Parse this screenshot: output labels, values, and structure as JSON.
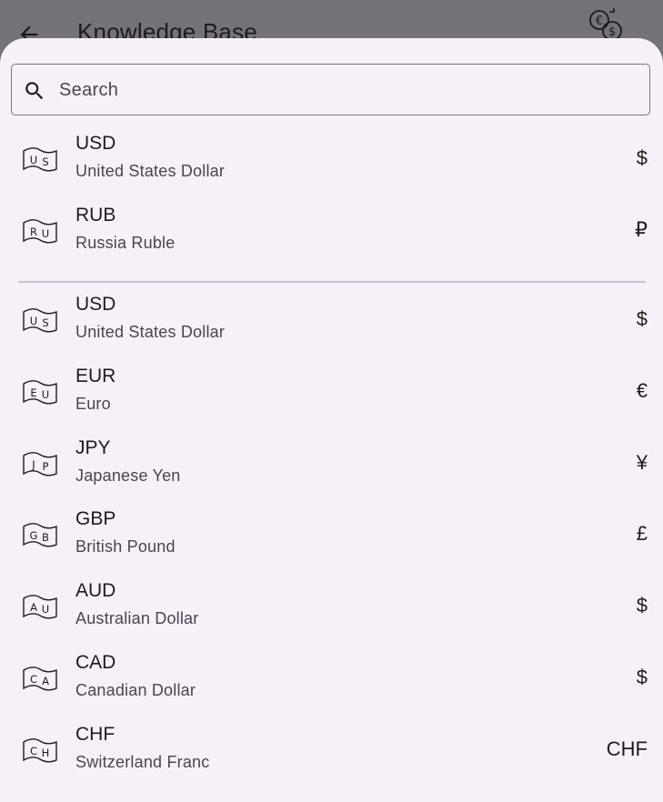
{
  "appbar": {
    "title": "Knowledge Base"
  },
  "search": {
    "placeholder": "Search",
    "value": ""
  },
  "pinned": [
    {
      "flag": "US",
      "code": "USD",
      "name": "United States Dollar",
      "symbol": "$"
    },
    {
      "flag": "RU",
      "code": "RUB",
      "name": "Russia Ruble",
      "symbol": "₽"
    }
  ],
  "all": [
    {
      "flag": "US",
      "code": "USD",
      "name": "United States Dollar",
      "symbol": "$"
    },
    {
      "flag": "EU",
      "code": "EUR",
      "name": "Euro",
      "symbol": "€"
    },
    {
      "flag": "JP",
      "code": "JPY",
      "name": "Japanese Yen",
      "symbol": "¥"
    },
    {
      "flag": "GB",
      "code": "GBP",
      "name": "British Pound",
      "symbol": "£"
    },
    {
      "flag": "AU",
      "code": "AUD",
      "name": "Australian Dollar",
      "symbol": "$"
    },
    {
      "flag": "CA",
      "code": "CAD",
      "name": "Canadian Dollar",
      "symbol": "$"
    },
    {
      "flag": "CH",
      "code": "CHF",
      "name": "Switzerland Franc",
      "symbol": "CHF"
    }
  ]
}
